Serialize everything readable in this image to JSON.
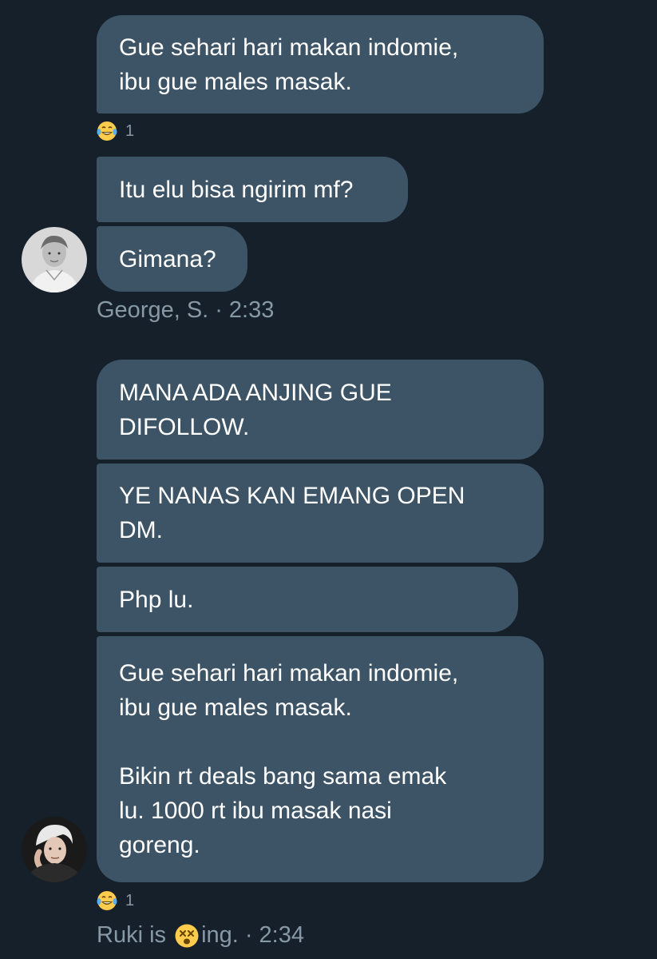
{
  "conversation": {
    "group1": {
      "messages": [
        "Gue sehari hari makan indomie,\nibu gue males masak.",
        "Itu elu bisa ngirim mf?",
        "Gimana?"
      ],
      "reaction_count": "1",
      "reaction_icon": "tears-of-joy-icon",
      "sender": "George, S.",
      "separator": "·",
      "time": "2:33"
    },
    "group2": {
      "messages": [
        "MANA ADA ANJING GUE\nDIFOLLOW.",
        "YE NANAS KAN EMANG OPEN\nDM.",
        "Php lu.",
        "Gue sehari hari makan indomie,\nibu gue males masak.\n\nBikin rt deals bang sama emak\nlu. 1000 rt ibu masak nasi\ngoreng."
      ],
      "reaction_count": "1",
      "reaction_icon": "tears-of-joy-icon",
      "sender_prefix": "Ruki is ",
      "sender_emoji": "dizzy-face-icon",
      "sender_suffix": "ing.",
      "separator": "·",
      "time": "2:34"
    }
  },
  "colors": {
    "background": "#15202b",
    "bubble": "#3d5466",
    "meta_text": "#8899a6"
  }
}
